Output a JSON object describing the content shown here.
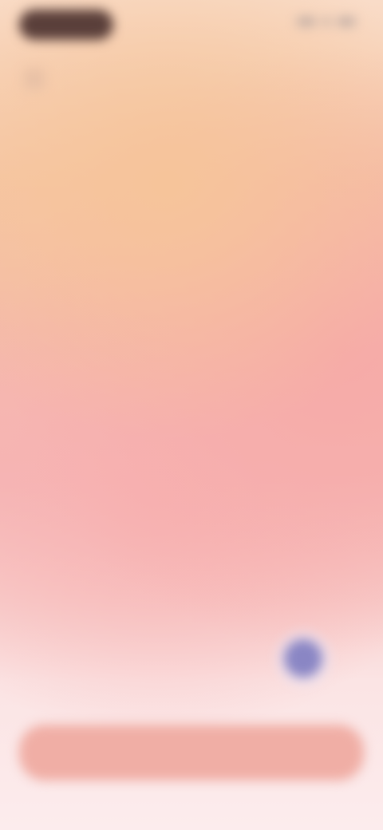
{
  "status_bar": {
    "pill_label": "",
    "icons": [
      "signal-icon",
      "battery-icon"
    ]
  },
  "header": {
    "icon": "app-icon",
    "subtitle": "",
    "title": ""
  },
  "content": {
    "section_label": "",
    "headline": ""
  },
  "composer": {
    "placeholder": "",
    "voice_icon": "microphone-icon",
    "accent_color": "#8a86c4"
  },
  "cta": {
    "label": "",
    "color": "#f0aea5"
  }
}
